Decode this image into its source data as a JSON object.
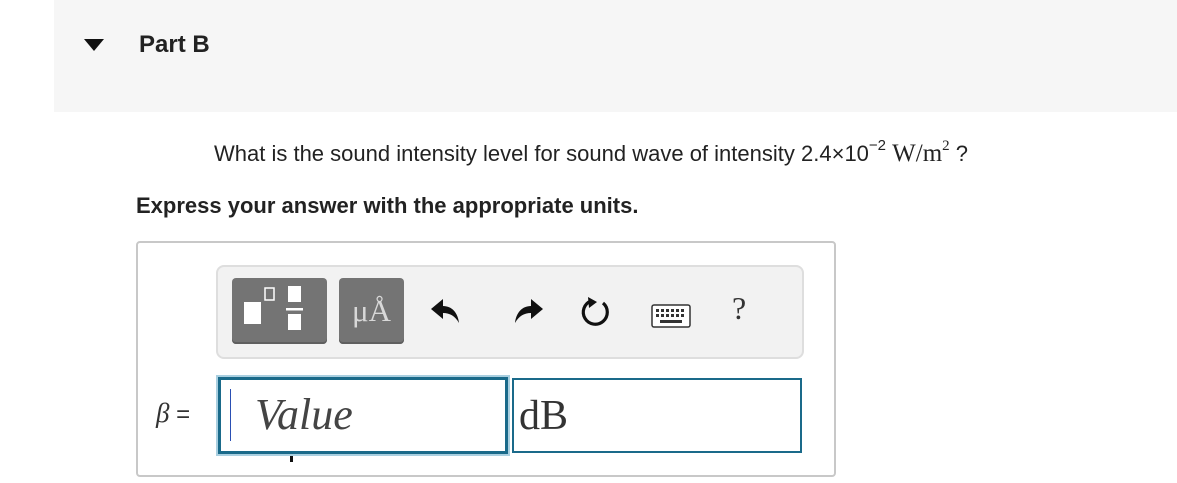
{
  "part": {
    "title": "Part B"
  },
  "question": {
    "text_before": "What is the sound intensity level for sound wave of intensity ",
    "mantissa": "2.4",
    "times": "×",
    "base": "10",
    "exponent": "−2",
    "unit_main": "W/m",
    "unit_exponent": "2",
    "text_after": " ?"
  },
  "instruction": "Express your answer with the appropriate units.",
  "toolbar": {
    "templates_icon": "templates-icon",
    "units_label": "μÅ",
    "undo_icon": "undo-icon",
    "redo_icon": "redo-icon",
    "reset_icon": "reset-icon",
    "keyboard_icon": "keyboard-icon",
    "help_label": "?"
  },
  "answer": {
    "variable": "β",
    "equals": " =",
    "value_placeholder": "Value",
    "units_value": "dB"
  },
  "colors": {
    "header_bg": "#f6f6f6",
    "toolbar_button_bg": "#747474",
    "input_border": "#1a6a8a",
    "input_focus_glow": "#a9cfe0"
  }
}
